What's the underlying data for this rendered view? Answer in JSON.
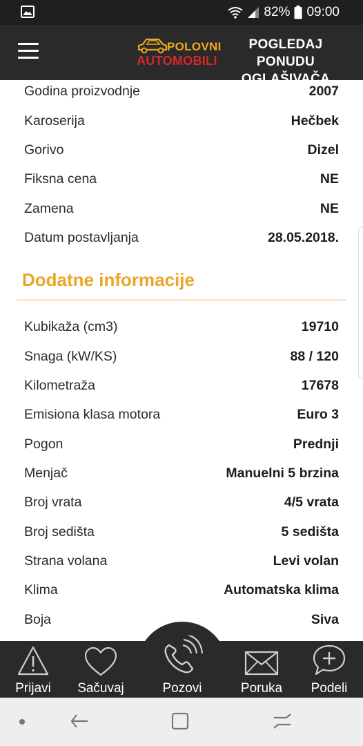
{
  "status_bar": {
    "battery": "82%",
    "time": "09:00"
  },
  "app_bar": {
    "logo_line1": "POLOVNI",
    "logo_line2": "AUTOMOBILI",
    "offer_line1": "POGLEDAJ PONUDU",
    "offer_line2": "OGLAŠIVAČA"
  },
  "basic_info": [
    {
      "label": "Godina proizvodnje",
      "value": "2007"
    },
    {
      "label": "Karoserija",
      "value": "Hečbek"
    },
    {
      "label": "Gorivo",
      "value": "Dizel"
    },
    {
      "label": "Fiksna cena",
      "value": "NE"
    },
    {
      "label": "Zamena",
      "value": "NE"
    },
    {
      "label": "Datum postavljanja",
      "value": "28.05.2018."
    }
  ],
  "additional": {
    "title": "Dodatne informacije",
    "rows": [
      {
        "label": "Kubikaža (cm3)",
        "value": "19710"
      },
      {
        "label": "Snaga (kW/KS)",
        "value": "88 / 120"
      },
      {
        "label": "Kilometraža",
        "value": "17678"
      },
      {
        "label": "Emisiona klasa motora",
        "value": "Euro 3"
      },
      {
        "label": "Pogon",
        "value": "Prednji"
      },
      {
        "label": "Menjač",
        "value": "Manuelni 5 brzina"
      },
      {
        "label": "Broj vrata",
        "value": "4/5 vrata"
      },
      {
        "label": "Broj sedišta",
        "value": "5 sedišta"
      },
      {
        "label": "Strana volana",
        "value": "Levi volan"
      },
      {
        "label": "Klima",
        "value": "Automatska klima"
      },
      {
        "label": "Boja",
        "value": "Siva"
      }
    ]
  },
  "bottom_nav": {
    "report": "Prijavi",
    "save": "Sačuvaj",
    "call": "Pozovi",
    "message": "Poruka",
    "share": "Podeli"
  },
  "colors": {
    "accent": "#eaa627",
    "bar": "#2a2a2a",
    "logo_red": "#d6262b"
  }
}
